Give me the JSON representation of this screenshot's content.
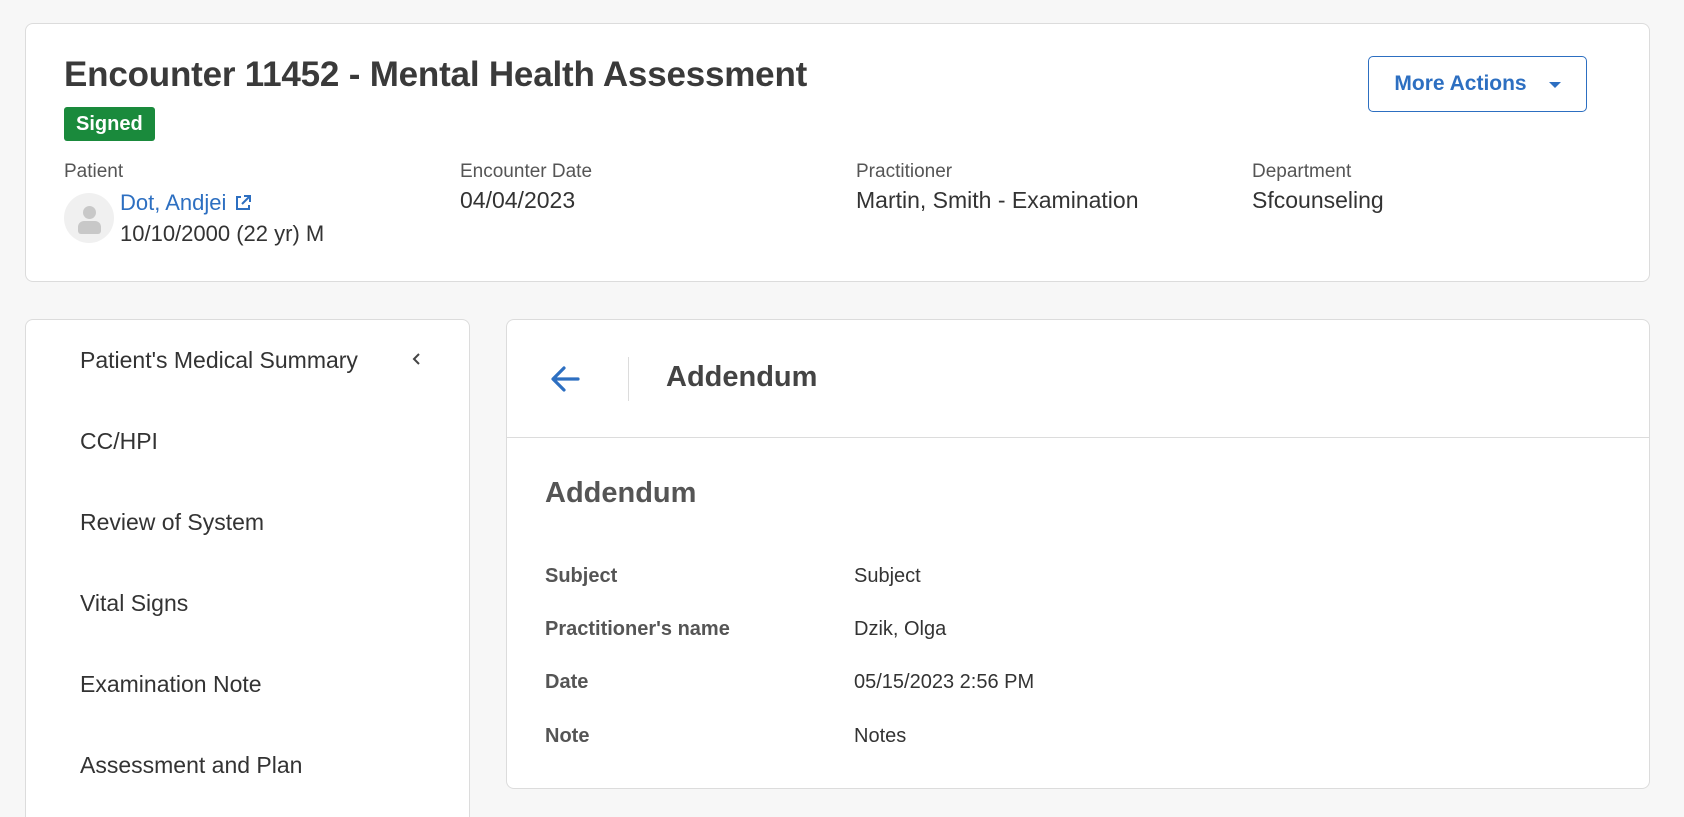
{
  "encounter": {
    "title": "Encounter 11452 - Mental Health Assessment",
    "status": "Signed",
    "status_color": "#1a8a3c",
    "more_actions_label": "More Actions",
    "patient_label": "Patient",
    "patient_name": "Dot, Andjei",
    "patient_dob": "10/10/2000 (22 yr) M",
    "encounter_date_label": "Encounter Date",
    "encounter_date": "04/04/2023",
    "practitioner_label": "Practitioner",
    "practitioner": "Martin, Smith - Examination",
    "department_label": "Department",
    "department": "Sfcounseling"
  },
  "sidebar": {
    "items": [
      {
        "label": "Patient's Medical Summary"
      },
      {
        "label": "CC/HPI"
      },
      {
        "label": "Review of System"
      },
      {
        "label": "Vital Signs"
      },
      {
        "label": "Examination Note"
      },
      {
        "label": "Assessment and Plan"
      }
    ]
  },
  "panel": {
    "header_title": "Addendum",
    "section_title": "Addendum",
    "fields": [
      {
        "label": "Subject",
        "value": "Subject"
      },
      {
        "label": "Practitioner's name",
        "value": "Dzik, Olga"
      },
      {
        "label": "Date",
        "value": "05/15/2023 2:56 PM"
      },
      {
        "label": "Note",
        "value": "Notes"
      }
    ]
  },
  "colors": {
    "accent": "#2d6fc1",
    "background": "#f7f7f7"
  },
  "icons": [
    "user-avatar-icon",
    "external-link-icon",
    "caret-down-icon",
    "chevron-left-icon",
    "arrow-left-icon"
  ]
}
